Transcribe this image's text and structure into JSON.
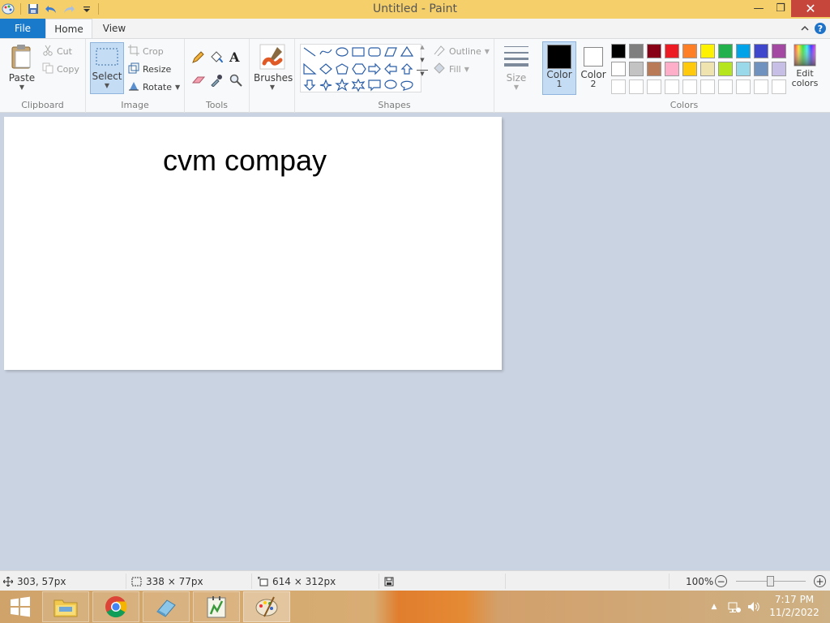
{
  "window": {
    "title": "Untitled - Paint",
    "controls": {
      "minimize": "—",
      "maximize": "❐",
      "close": "✕"
    }
  },
  "tabs": {
    "file": "File",
    "home": "Home",
    "view": "View"
  },
  "ribbon": {
    "clipboard": {
      "label": "Clipboard",
      "paste": "Paste",
      "cut": "Cut",
      "copy": "Copy"
    },
    "image": {
      "label": "Image",
      "select": "Select",
      "crop": "Crop",
      "resize": "Resize",
      "rotate": "Rotate"
    },
    "tools": {
      "label": "Tools"
    },
    "brushes": {
      "label": "Brushes"
    },
    "shapes": {
      "label": "Shapes",
      "outline": "Outline",
      "fill": "Fill"
    },
    "size": {
      "label": "Size"
    },
    "colors": {
      "label": "Colors",
      "color1": "Color",
      "color1_num": "1",
      "color2": "Color",
      "color2_num": "2",
      "edit_colors_1": "Edit",
      "edit_colors_2": "colors",
      "color1_value": "#000000",
      "color2_value": "#ffffff",
      "palette_row1": [
        "#000000",
        "#7f7f7f",
        "#880015",
        "#ed1c24",
        "#ff7f27",
        "#fff200",
        "#22b14c",
        "#00a2e8",
        "#3f48cc",
        "#a349a4"
      ],
      "palette_row2": [
        "#ffffff",
        "#c3c3c3",
        "#b97a57",
        "#ffaec9",
        "#ffc90e",
        "#efe4b0",
        "#b5e61d",
        "#99d9ea",
        "#7092be",
        "#c8bfe7"
      ]
    }
  },
  "canvas": {
    "text": "cvm compay"
  },
  "status": {
    "cursor_pos": "303, 57px",
    "selection_size": "338 × 77px",
    "image_size": "614 × 312px",
    "zoom": "100%"
  },
  "taskbar": {
    "time": "7:17 PM",
    "date": "11/2/2022"
  }
}
